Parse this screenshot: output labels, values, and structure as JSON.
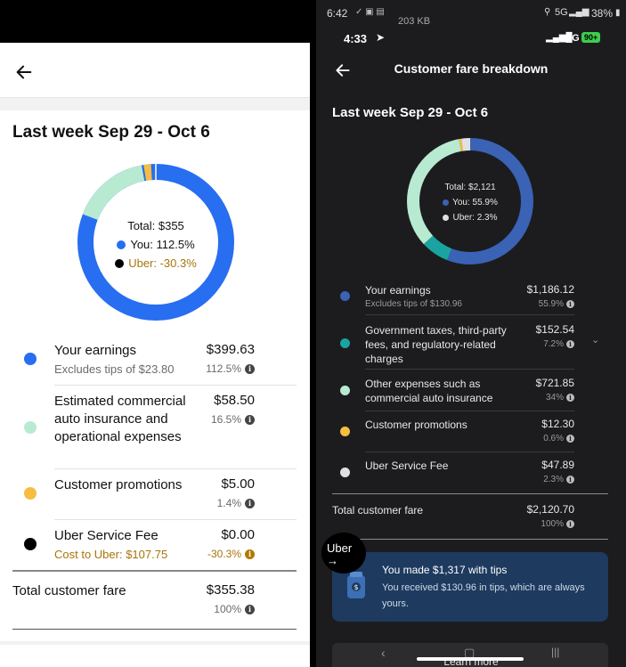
{
  "left": {
    "title": "Last week Sep 29 - Oct 6",
    "center": {
      "total": "Total: $355",
      "you": "You: 112.5%",
      "uber": "Uber: -30.3%"
    },
    "rows": [
      {
        "label": "Your earnings",
        "sub": "Excludes tips of $23.80",
        "amount": "$399.63",
        "pct": "112.5%",
        "color": "#276ef1"
      },
      {
        "label": "Estimated commercial auto insurance and operational expenses",
        "sub": "",
        "amount": "$58.50",
        "pct": "16.5%",
        "color": "#b8ead2"
      },
      {
        "label": "Customer promotions",
        "sub": "",
        "amount": "$5.00",
        "pct": "1.4%",
        "color": "#f6bd41"
      },
      {
        "label": "Uber Service Fee",
        "sub": "Cost to Uber: $107.75",
        "amount": "$0.00",
        "pct": "-30.3%",
        "color": "#000000"
      }
    ],
    "total": {
      "label": "Total customer fare",
      "amount": "$355.38",
      "pct": "100%"
    }
  },
  "right": {
    "status": {
      "time_small": "6:42",
      "battery": "38%",
      "net": "5G",
      "time_big": "4:33",
      "net2": "5G",
      "bat2": "90+",
      "kb": "203 KB"
    },
    "header_title": "Customer fare breakdown",
    "title": "Last week Sep 29 - Oct 6",
    "center": {
      "total": "Total: $2,121",
      "you": "You: 55.9%",
      "uber": "Uber: 2.3%"
    },
    "rows": [
      {
        "label": "Your earnings",
        "sub": "Excludes tips of $130.96",
        "amount": "$1,186.12",
        "pct": "55.9%",
        "color": "#3a62b5"
      },
      {
        "label": "Government taxes, third-party fees, and regulatory-related charges",
        "sub": "",
        "amount": "$152.54",
        "pct": "7.2%",
        "color": "#1aa3a0"
      },
      {
        "label": "Other expenses such as commercial auto insurance",
        "sub": "",
        "amount": "$721.85",
        "pct": "34%",
        "color": "#b8ead2"
      },
      {
        "label": "Customer promotions",
        "sub": "",
        "amount": "$12.30",
        "pct": "0.6%",
        "color": "#f6bd41"
      },
      {
        "label": "Uber Service Fee",
        "sub": "",
        "amount": "$47.89",
        "pct": "2.3%",
        "color": "#e0e0e0"
      }
    ],
    "total": {
      "label": "Total customer fare",
      "amount": "$2,120.70",
      "pct": "100%"
    },
    "tips": {
      "title": "You made $1,317 with tips",
      "body": "You received $130.96 in tips, which are always yours."
    },
    "bubble": {
      "label": "Uber",
      "arrow": "→"
    },
    "learn_more": "Learn more"
  }
}
